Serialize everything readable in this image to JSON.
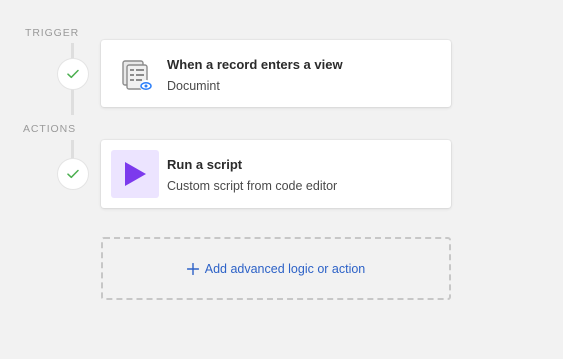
{
  "trigger_section": {
    "label": "TRIGGER"
  },
  "actions_section": {
    "label": "ACTIONS"
  },
  "trigger": {
    "title": "When a record enters a view",
    "subtitle": "Documint",
    "icon": "record-view-icon"
  },
  "action": {
    "title": "Run a script",
    "subtitle": "Custom script from code editor",
    "icon": "play-icon"
  },
  "add": {
    "label": "Add advanced logic or action",
    "icon": "plus-icon"
  },
  "colors": {
    "check": "#4caf50",
    "script_bg": "#ece4ff",
    "script_play": "#7c3aed",
    "link": "#2d62c7",
    "eye_badge": "#2d7ff9"
  }
}
